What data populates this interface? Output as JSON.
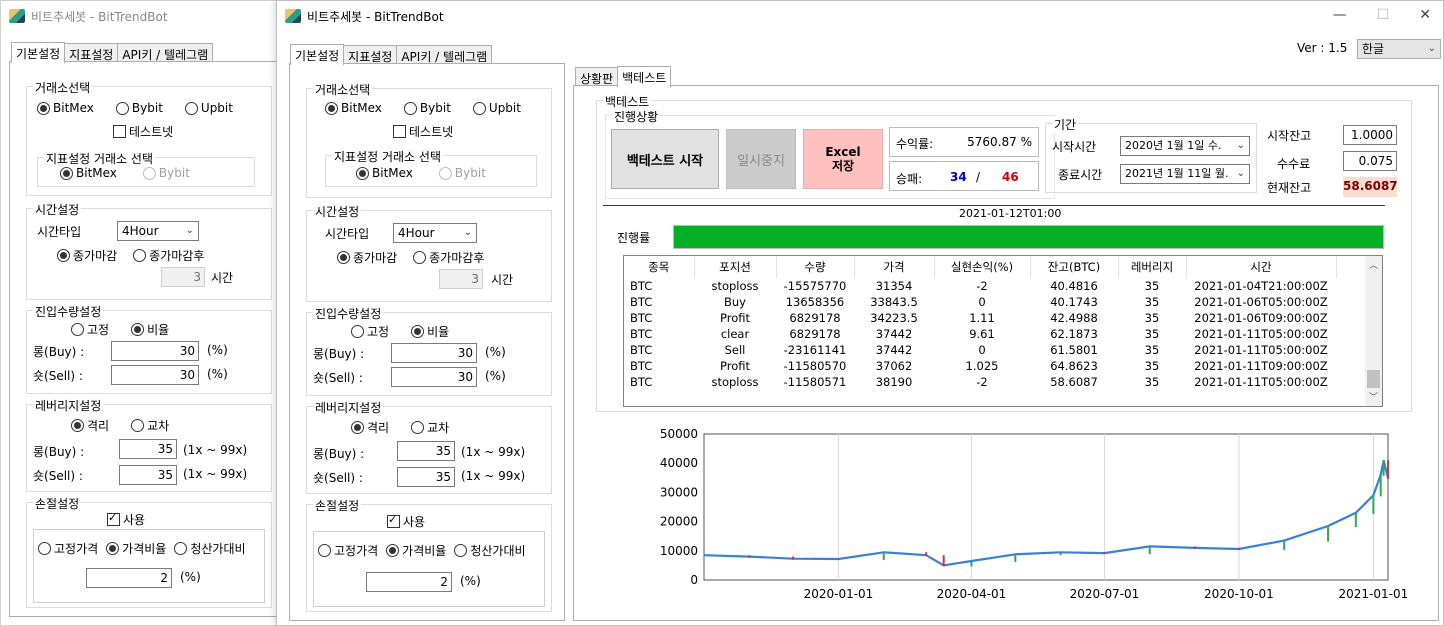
{
  "app_title": "비트추세봇 - BitTrendBot",
  "left_tabs": [
    "기본설정",
    "지표설정",
    "API키 / 텔레그램"
  ],
  "exchange": {
    "title": "거래소선택",
    "options": [
      "BitMex",
      "Bybit",
      "Upbit"
    ],
    "selected": "BitMex",
    "testnet_label": "테스트넷",
    "testnet_checked": false,
    "indicator_title": "지표설정 거래소 선택",
    "indicator_options": [
      "BitMex",
      "Bybit"
    ]
  },
  "time": {
    "title": "시간설정",
    "type_label": "시간타입",
    "type_value": "4Hour",
    "close_options": [
      "종가마감",
      "종가마감후"
    ],
    "hours_value": "3",
    "hours_unit": "시간"
  },
  "entry": {
    "title": "진입수량설정",
    "mode_options": [
      "고정",
      "비율"
    ],
    "long_label": "롱(Buy) :",
    "long_value": "30",
    "short_label": "숏(Sell) :",
    "short_value": "30",
    "unit": "(%)"
  },
  "leverage": {
    "title": "레버리지설정",
    "mode_options": [
      "격리",
      "교차"
    ],
    "long_label": "롱(Buy) :",
    "long_value": "35",
    "short_label": "숏(Sell) :",
    "short_value": "35",
    "range": "(1x ~ 99x)"
  },
  "stoploss": {
    "title": "손절설정",
    "use_label": "사용",
    "use_checked": true,
    "options": [
      "고정가격",
      "가격비율",
      "청산가대비"
    ],
    "value": "2",
    "unit": "(%)"
  },
  "header": {
    "version": "Ver : 1.5",
    "language": "한글"
  },
  "right_tabs": [
    "상황판",
    "백테스트"
  ],
  "backtest": {
    "title": "백테스트",
    "progress_group": "진행상황",
    "start_btn": "백테스트 시작",
    "pause_btn": "일시중지",
    "excel_btn_line1": "Excel",
    "excel_btn_line2": "저장",
    "return_label": "수익률:",
    "return_value": "5760.87 %",
    "winloss_label": "승패:",
    "wins": "34",
    "slash": "/",
    "losses": "46",
    "period_title": "기간",
    "start_label": "시작시간",
    "start_value": "2020년   1월   1일 수.",
    "end_label": "종료시간",
    "end_value": "2021년   1월  11일 월.",
    "init_balance_label": "시작잔고",
    "init_balance": "1.0000",
    "fee_label": "수수료",
    "fee": "0.075",
    "cur_balance_label": "현재잔고",
    "cur_balance": "58.6087",
    "timestamp": "2021-01-12T01:00",
    "progress_label": "진행률",
    "progress_fraction": 1.0,
    "columns": [
      "종목",
      "포지션",
      "수량",
      "가격",
      "실현손익(%)",
      "잔고(BTC)",
      "레버리지",
      "시간"
    ],
    "rows": [
      [
        "BTC",
        "stoploss",
        "-15575770",
        "31354",
        "-2",
        "40.4816",
        "35",
        "2021-01-04T21:00:00Z"
      ],
      [
        "BTC",
        "Buy",
        "13658356",
        "33843.5",
        "0",
        "40.1743",
        "35",
        "2021-01-06T05:00:00Z"
      ],
      [
        "BTC",
        "Profit",
        "6829178",
        "34223.5",
        "1.11",
        "42.4988",
        "35",
        "2021-01-06T09:00:00Z"
      ],
      [
        "BTC",
        "clear",
        "6829178",
        "37442",
        "9.61",
        "62.1873",
        "35",
        "2021-01-11T05:00:00Z"
      ],
      [
        "BTC",
        "Sell",
        "-23161141",
        "37442",
        "0",
        "61.5801",
        "35",
        "2021-01-11T05:00:00Z"
      ],
      [
        "BTC",
        "Profit",
        "-11580570",
        "37062",
        "1.025",
        "64.8623",
        "35",
        "2021-01-11T09:00:00Z"
      ],
      [
        "BTC",
        "stoploss",
        "-11580571",
        "38190",
        "-2",
        "58.6087",
        "35",
        "2021-01-11T05:00:00Z"
      ]
    ]
  },
  "chart_data": {
    "type": "line",
    "y_ticks": [
      "50000",
      "40000",
      "30000",
      "20000",
      "10000",
      "0"
    ],
    "x_ticks": [
      "2020-01-01",
      "2020-04-01",
      "2020-07-01",
      "2020-10-01",
      "2021-01-01"
    ],
    "ylim": [
      0,
      50000
    ],
    "x": [
      "2019-10-01",
      "2019-11-01",
      "2019-12-01",
      "2020-01-01",
      "2020-02-01",
      "2020-03-01",
      "2020-03-13",
      "2020-04-01",
      "2020-05-01",
      "2020-06-01",
      "2020-07-01",
      "2020-08-01",
      "2020-09-01",
      "2020-10-01",
      "2020-11-01",
      "2020-12-01",
      "2020-12-20",
      "2021-01-01",
      "2021-01-06",
      "2021-01-08",
      "2021-01-11"
    ],
    "y": [
      8500,
      8000,
      7300,
      7200,
      9500,
      8500,
      5000,
      6500,
      8800,
      9500,
      9200,
      11500,
      11000,
      10600,
      13500,
      18500,
      23000,
      29000,
      36000,
      41000,
      35000
    ],
    "grid": true,
    "colors": {
      "line": "#3b7fd9",
      "up": "#2eaa4c",
      "down": "#d63333"
    }
  },
  "colors": {
    "progress": "#06b025",
    "excel_bg": "#ffc0c0",
    "btn_gray": "#e1e1e1",
    "win_blue": "#0000cc",
    "loss_red": "#cc0000"
  }
}
